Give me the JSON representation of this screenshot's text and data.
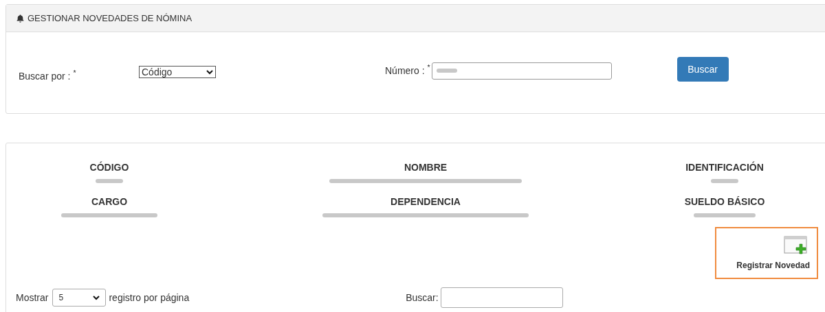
{
  "search_panel": {
    "title": "GESTIONAR NOVEDADES DE NÓMINA",
    "search_by": {
      "label": "Buscar por :",
      "required_mark": "*",
      "value": "Código"
    },
    "number": {
      "label": "Número :",
      "required_mark": "*"
    },
    "search_button": "Buscar"
  },
  "employee": {
    "fields": [
      {
        "label": "CÓDIGO"
      },
      {
        "label": "NOMBRE"
      },
      {
        "label": "IDENTIFICACIÓN"
      },
      {
        "label": "CARGO"
      },
      {
        "label": "DEPENDENCIA"
      },
      {
        "label": "SUELDO BÁSICO"
      }
    ],
    "register_button": {
      "label": "Registrar Novedad",
      "highlighted": true
    },
    "show": {
      "label": "Mostrar",
      "value": "5",
      "suffix": "registro por página"
    },
    "filter": {
      "label": "Buscar:"
    }
  }
}
